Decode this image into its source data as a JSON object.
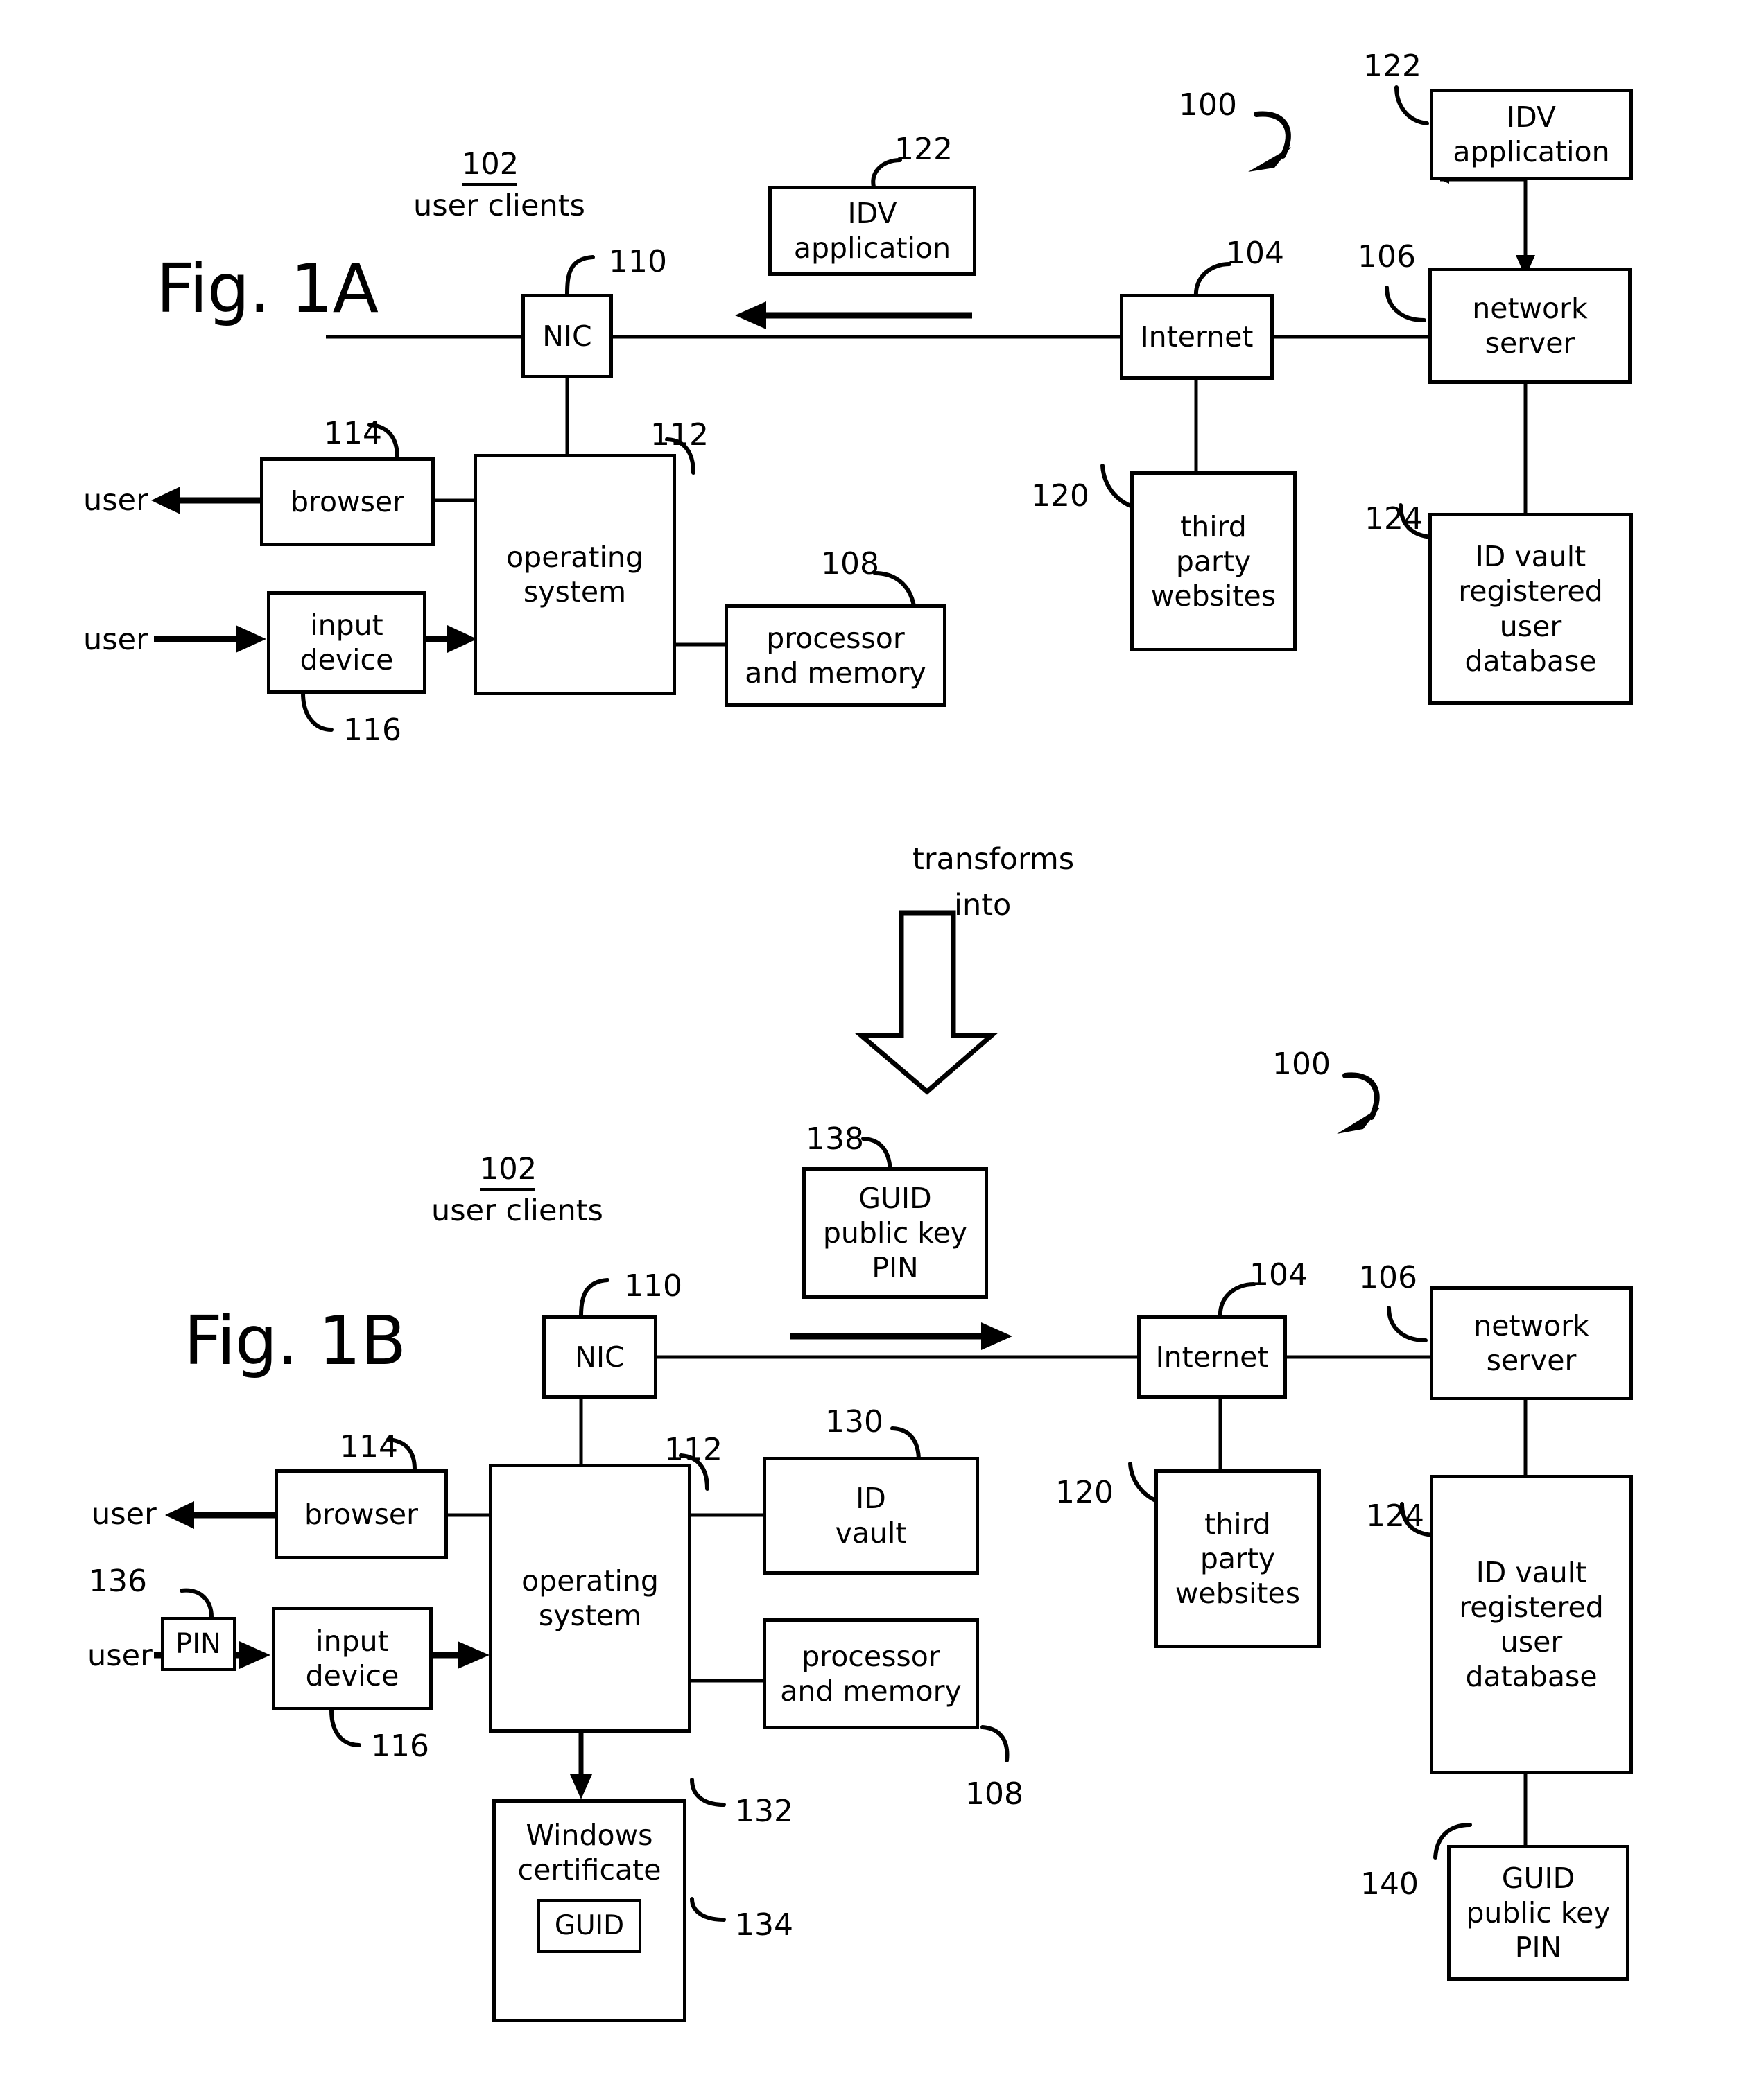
{
  "figures": {
    "figA": {
      "title": "Fig. 1A",
      "system_ref": "100",
      "group": {
        "number": "102",
        "label": "user clients"
      },
      "boxes": {
        "nic": "NIC",
        "idv_application": "IDV\napplication",
        "internet": "Internet",
        "network_server": "network\nserver",
        "idv_application_server": "IDV\napplication",
        "third_party_websites": "third\nparty\nwebsites",
        "id_vault_db": "ID vault\nregistered\nuser\ndatabase",
        "browser": "browser",
        "input_device": "input\ndevice",
        "operating_system": "operating\nsystem",
        "processor_memory": "processor\nand memory"
      },
      "refs": {
        "nic": "110",
        "idv_application": "122",
        "internet": "104",
        "network_server": "106",
        "idv_application_server": "122",
        "third_party_websites": "120",
        "id_vault_db": "124",
        "browser": "114",
        "input_device": "116",
        "operating_system": "112",
        "processor_memory": "108"
      },
      "actors": {
        "user_out": "user",
        "user_in": "user"
      }
    },
    "transform": {
      "line1": "transforms",
      "line2": "into"
    },
    "figB": {
      "title": "Fig. 1B",
      "system_ref": "100",
      "group": {
        "number": "102",
        "label": "user clients"
      },
      "boxes": {
        "nic": "NIC",
        "guid_packet": "GUID\npublic key\nPIN",
        "internet": "Internet",
        "network_server": "network\nserver",
        "third_party_websites": "third\nparty\nwebsites",
        "id_vault_db": "ID vault\nregistered\nuser\ndatabase",
        "guid_record": "GUID\npublic key\nPIN",
        "browser": "browser",
        "pin": "PIN",
        "input_device": "input\ndevice",
        "operating_system": "operating\nsystem",
        "id_vault": "ID\nvault",
        "processor_memory": "processor\nand memory",
        "windows_certificate": "Windows\ncertificate",
        "guid": "GUID"
      },
      "refs": {
        "nic": "110",
        "guid_packet": "138",
        "internet": "104",
        "network_server": "106",
        "third_party_websites": "120",
        "id_vault_db": "124",
        "guid_record": "140",
        "browser": "114",
        "pin": "136",
        "input_device": "116",
        "operating_system": "112",
        "id_vault": "130",
        "processor_memory": "108",
        "windows_certificate": "132",
        "guid": "134"
      },
      "actors": {
        "user_out": "user",
        "user_in": "user"
      }
    }
  },
  "colors": {
    "ink": "#000000",
    "paper": "#ffffff"
  }
}
